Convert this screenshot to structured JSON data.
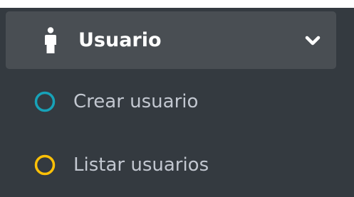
{
  "menu": {
    "header": {
      "label": "Usuario",
      "icon": "person-icon",
      "expand_icon": "chevron-down-icon",
      "expanded": true
    },
    "items": [
      {
        "label": "Crear usuario",
        "icon": "circle-outline-icon",
        "color": "#17a2b8"
      },
      {
        "label": "Listar usuarios",
        "icon": "circle-outline-icon",
        "color": "#ffc107"
      }
    ]
  },
  "colors": {
    "sidebar_bg": "#343a40",
    "header_bg": "#494e53",
    "text_primary": "#ffffff",
    "text_secondary": "#c2c7d0"
  }
}
